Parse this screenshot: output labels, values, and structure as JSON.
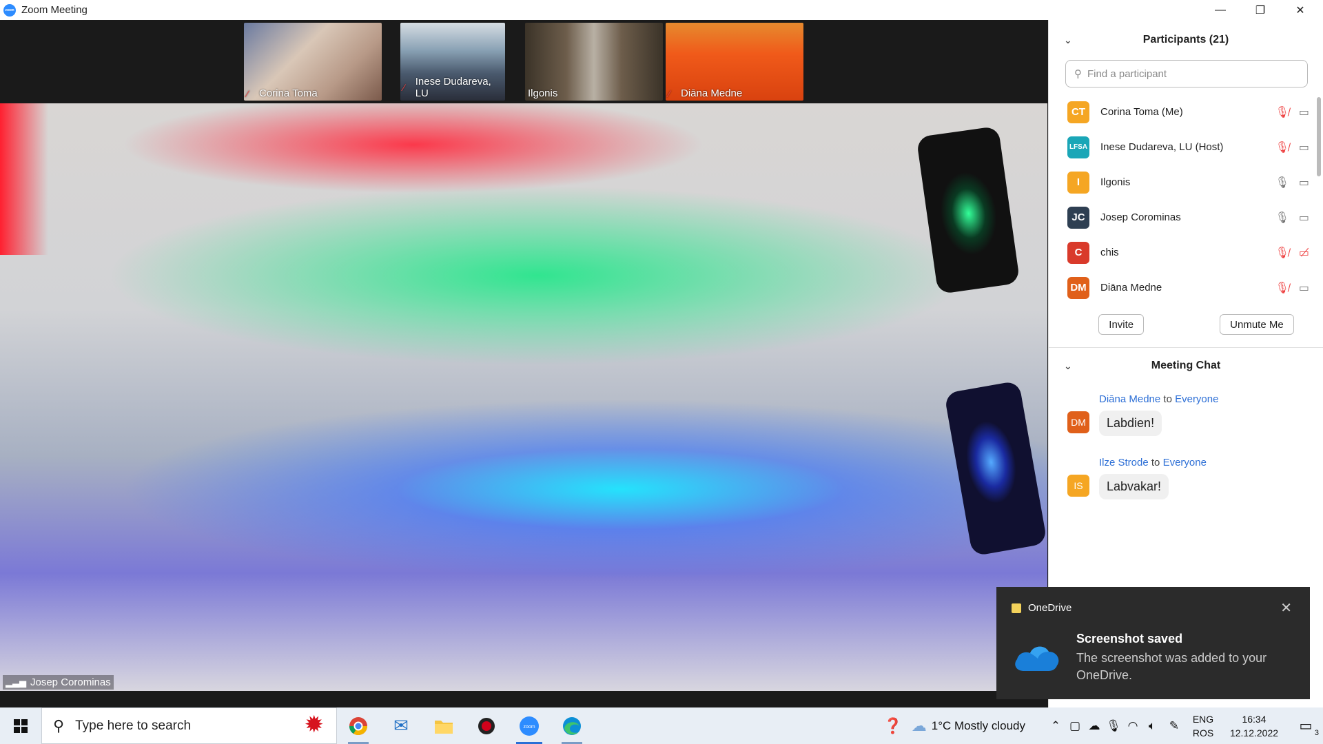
{
  "window": {
    "title": "Zoom Meeting",
    "minimize": "—",
    "restore": "❐",
    "close": "✕"
  },
  "thumbnails": [
    {
      "name": "Corina Toma",
      "muted": true
    },
    {
      "name": "Inese Dudareva, LU",
      "muted": true
    },
    {
      "name": "Ilgonis",
      "muted": false
    },
    {
      "name": "Diāna Medne",
      "muted": true
    }
  ],
  "active_speaker": {
    "name": "Josep Corominas"
  },
  "participants": {
    "header": "Participants (21)",
    "search_placeholder": "Find a participant",
    "list": [
      {
        "initials": "CT",
        "name": "Corina Toma (Me)",
        "color": "#f5a623",
        "mic": "off",
        "video": "off"
      },
      {
        "initials": "LFSA",
        "name": "Inese Dudareva, LU (Host)",
        "color": "#1aa6b7",
        "mic": "off",
        "video": "off"
      },
      {
        "initials": "I",
        "name": "Ilgonis",
        "color": "#f5a623",
        "mic": "on",
        "video": "off"
      },
      {
        "initials": "JC",
        "name": "Josep Corominas",
        "color": "#2e3f52",
        "mic": "on",
        "video": "off"
      },
      {
        "initials": "C",
        "name": "chis",
        "color": "#d93a2b",
        "mic": "off",
        "video": "disabled"
      },
      {
        "initials": "DM",
        "name": "Diāna Medne",
        "color": "#e0601a",
        "mic": "off",
        "video": "off"
      }
    ],
    "invite_label": "Invite",
    "unmute_label": "Unmute Me"
  },
  "chat": {
    "header": "Meeting Chat",
    "messages": [
      {
        "from": "Diāna Medne",
        "to_word": "to",
        "to": "Everyone",
        "initials": "DM",
        "color": "#e0601a",
        "text": "Labdien!"
      },
      {
        "from": "Ilze Strode",
        "to_word": "to",
        "to": "Everyone",
        "initials": "IS",
        "color": "#f5a623",
        "text": "Labvakar!"
      }
    ]
  },
  "toast": {
    "app": "OneDrive",
    "heading": "Screenshot saved",
    "body": "The screenshot was added to your OneDrive."
  },
  "taskbar": {
    "search_placeholder": "Type here to search",
    "weather": "1°C  Mostly cloudy",
    "lang_top": "ENG",
    "lang_bottom": "ROS",
    "time": "16:34",
    "date": "12.12.2022",
    "notifications": "3"
  }
}
